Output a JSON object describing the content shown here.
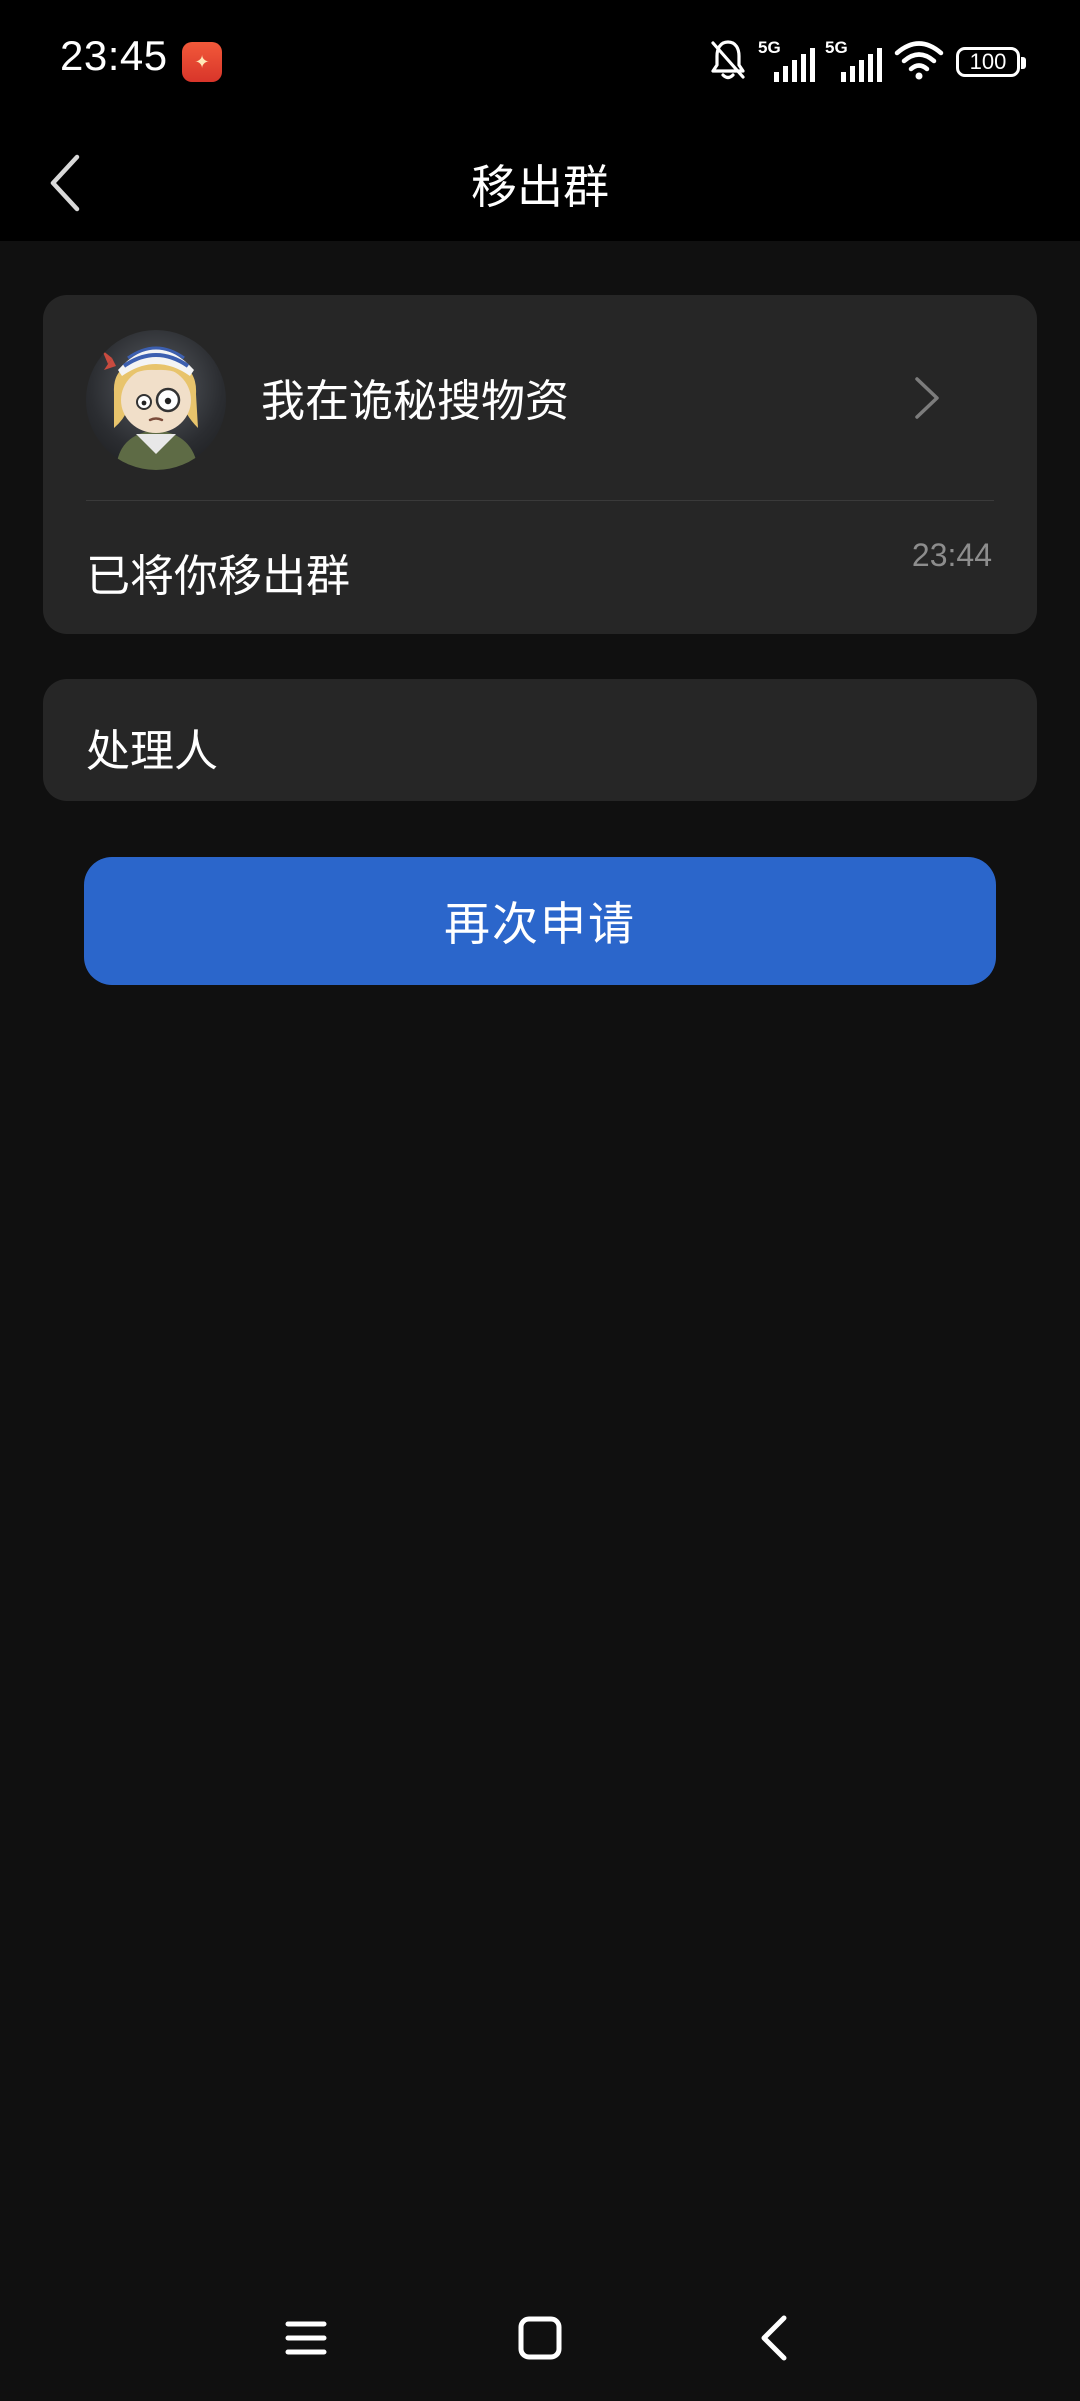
{
  "status_bar": {
    "time": "23:45",
    "network_1": "5G",
    "network_2": "5G",
    "battery": "100",
    "icons": [
      "app-notification-icon",
      "mute-bell-icon",
      "signal-icon",
      "signal-icon",
      "wifi-icon",
      "battery-icon"
    ]
  },
  "header": {
    "title": "移出群",
    "back_icon": "chevron-left-icon"
  },
  "group_card": {
    "group_name": "我在诡秘搜物资",
    "notice": "已将你移出群",
    "time": "23:44",
    "arrow_icon": "chevron-right-icon"
  },
  "handler_card": {
    "label": "处理人"
  },
  "actions": {
    "reapply_label": "再次申请",
    "reapply_color": "#2b66cb"
  },
  "nav_bar": {
    "icons": [
      "menu-icon",
      "home-icon",
      "back-icon"
    ]
  }
}
